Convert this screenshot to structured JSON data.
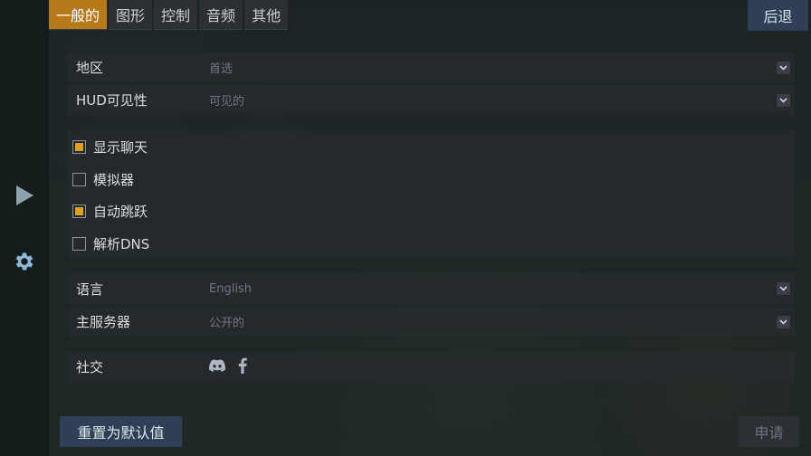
{
  "tabs": [
    {
      "label": "一般的",
      "active": true
    },
    {
      "label": "图形",
      "active": false
    },
    {
      "label": "控制",
      "active": false
    },
    {
      "label": "音频",
      "active": false
    },
    {
      "label": "其他",
      "active": false
    }
  ],
  "back_label": "后退",
  "settings": {
    "region": {
      "label": "地区",
      "value": "首选"
    },
    "hud": {
      "label": "HUD可见性",
      "value": "可见的"
    },
    "language": {
      "label": "语言",
      "value": "English"
    },
    "main_server": {
      "label": "主服务器",
      "value": "公开的"
    },
    "social": {
      "label": "社交"
    }
  },
  "checkboxes": [
    {
      "label": "显示聊天",
      "checked": true
    },
    {
      "label": "模拟器",
      "checked": false
    },
    {
      "label": "自动跳跃",
      "checked": true
    },
    {
      "label": "解析DNS",
      "checked": false
    }
  ],
  "reset_label": "重置为默认值",
  "apply_label": "申请",
  "colors": {
    "accent": "#b8791a",
    "check_fill": "#e0a020",
    "button_blue": "#2f3f55"
  },
  "icons": {
    "rail_top": "play-icon",
    "rail_bottom": "gear-icon",
    "social": [
      "discord-icon",
      "facebook-icon"
    ]
  }
}
